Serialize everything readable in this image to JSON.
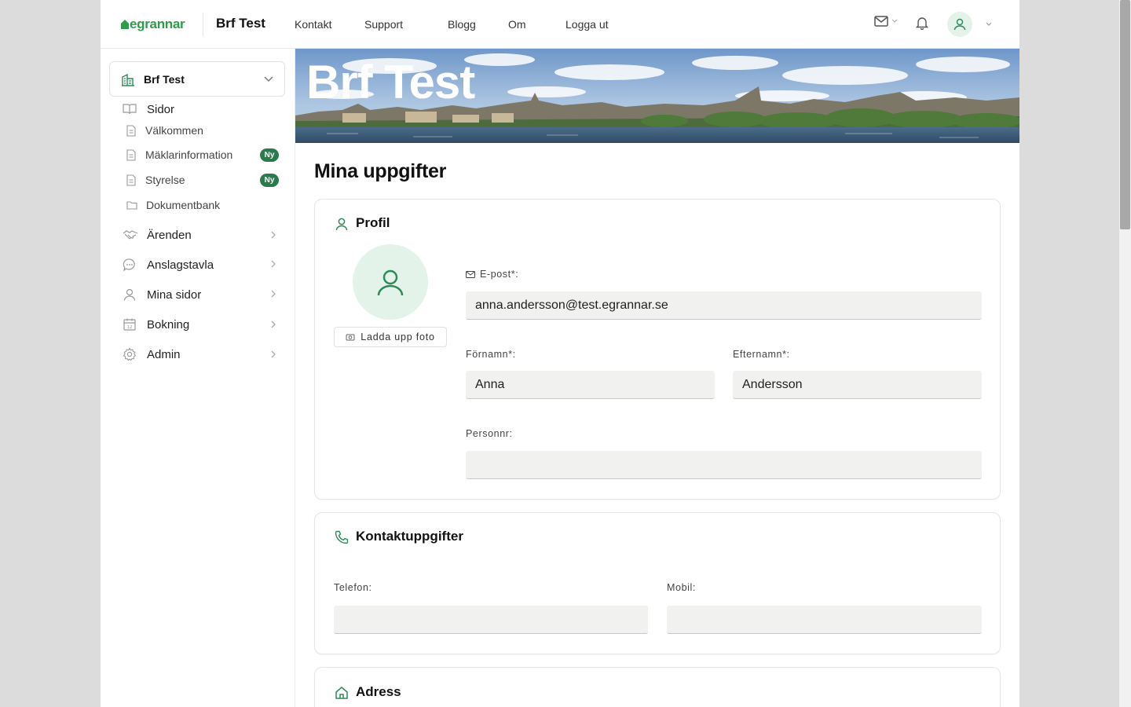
{
  "header": {
    "logo_text": "egrannar",
    "brand": "Brf Test",
    "nav": [
      "Kontakt",
      "Support",
      "Blogg",
      "Om",
      "Logga ut"
    ],
    "icons": [
      "mail-icon",
      "bell-icon",
      "user-icon"
    ]
  },
  "sidebar": {
    "org_name": "Brf Test",
    "sections": {
      "sidor": "Sidor",
      "pages": [
        {
          "label": "Välkommen",
          "badge": ""
        },
        {
          "label": "Mäklarinformation",
          "badge": "Ny"
        },
        {
          "label": "Styrelse",
          "badge": "Ny"
        },
        {
          "label": "Dokumentbank",
          "badge": ""
        }
      ],
      "items": [
        "Ärenden",
        "Anslagstavla",
        "Mina sidor",
        "Bokning",
        "Admin"
      ]
    }
  },
  "banner": {
    "title": "Brf Test"
  },
  "main": {
    "title": "Mina uppgifter",
    "profile": {
      "title": "Profil",
      "upload_label": "Ladda upp foto",
      "email_label": "E-post",
      "email_value": "anna.andersson@test.egrannar.se",
      "first_name_label": "Förnamn",
      "first_name_value": "Anna",
      "last_name_label": "Efternamn",
      "last_name_value": "Andersson",
      "personnr_label": "Personnr:",
      "personnr_value": ""
    },
    "contact": {
      "title": "Kontaktuppgifter",
      "phone_label": "Telefon:",
      "phone_value": "",
      "mobile_label": "Mobil:",
      "mobile_value": ""
    },
    "address": {
      "title": "Adress"
    }
  },
  "colors": {
    "accent": "#2e9d4b",
    "badge": "#2a7a4e",
    "avatar_bg": "#e3f3ea",
    "input_bg": "#f1f1f0"
  }
}
